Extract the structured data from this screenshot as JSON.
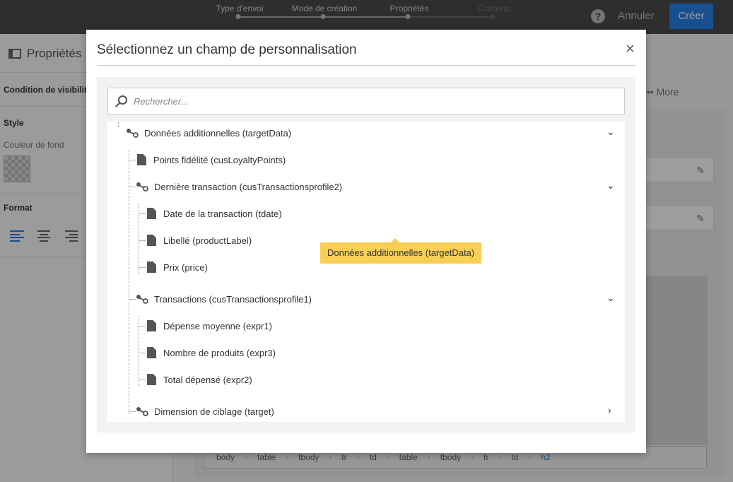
{
  "topbar": {
    "steps": [
      {
        "label": "Type d'envoi",
        "active": true
      },
      {
        "label": "Mode de création",
        "active": true
      },
      {
        "label": "Propriétés",
        "active": true
      },
      {
        "label": "Contenu",
        "active": false
      }
    ],
    "help_icon": "question-circle-icon",
    "cancel_label": "Annuler",
    "create_label": "Créer",
    "accent_color": "#2680eb"
  },
  "left_panel": {
    "title": "Propriétés",
    "visibility_label": "Condition de visibilité",
    "style_label": "Style",
    "bg_color_label": "Couleur de fond",
    "format_label": "Format"
  },
  "right_panel": {
    "more_label": "More",
    "breadcrumb": [
      "body",
      "table",
      "tbody",
      "tr",
      "td",
      "table",
      "tbody",
      "tr",
      "td",
      "h2"
    ]
  },
  "modal": {
    "title": "Sélectionnez un champ de personnalisation",
    "close_icon": "close-icon",
    "search_placeholder": "Rechercher...",
    "tooltip": "Données additionnelles (targetData)",
    "tree": {
      "root": {
        "label": "Données additionnelles (targetData)",
        "expanded": true
      },
      "loyalty": {
        "label": "Points fidélité (cusLoyaltyPoints)"
      },
      "last_tx": {
        "label": "Dernière transaction (cusTransactionsprofile2)",
        "expanded": true
      },
      "tdate": {
        "label": "Date de la transaction (tdate)"
      },
      "plabel": {
        "label": "Libellé (productLabel)"
      },
      "price": {
        "label": "Prix (price)"
      },
      "tx": {
        "label": "Transactions (cusTransactionsprofile1)",
        "expanded": true
      },
      "expr1": {
        "label": "Dépense moyenne (expr1)"
      },
      "expr3": {
        "label": "Nombre de produits (expr3)"
      },
      "expr2": {
        "label": "Total dépensé (expr2)"
      },
      "target": {
        "label": "Dimension de ciblage (target)",
        "expanded": false
      }
    }
  }
}
